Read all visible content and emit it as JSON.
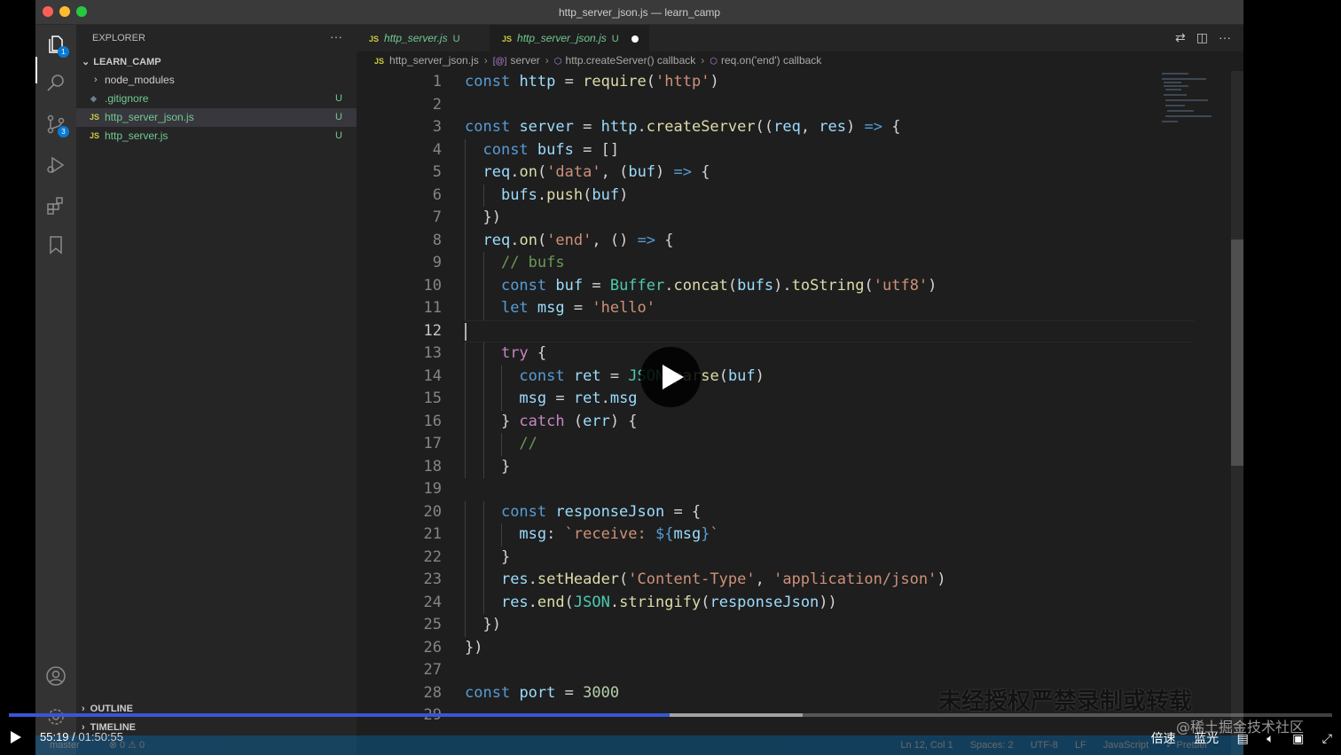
{
  "window": {
    "title": "http_server_json.js — learn_camp"
  },
  "activity_bar": {
    "explorer_badge": "1",
    "scm_badge": "3"
  },
  "sidebar": {
    "header": "EXPLORER",
    "more": "···",
    "section": "LEARN_CAMP",
    "items": [
      {
        "label": "node_modules",
        "status": "",
        "icon": "chevron-right-icon"
      },
      {
        "label": ".gitignore",
        "status": "U",
        "icon": "gitignore-icon"
      },
      {
        "label": "http_server_json.js",
        "status": "U",
        "icon": "JS"
      },
      {
        "label": "http_server.js",
        "status": "U",
        "icon": "JS"
      }
    ],
    "outline": "OUTLINE",
    "timeline": "TIMELINE"
  },
  "tabs": [
    {
      "icon": "JS",
      "label": "http_server.js",
      "status": "U"
    },
    {
      "icon": "JS",
      "label": "http_server_json.js",
      "status": "U"
    }
  ],
  "breadcrumb": {
    "file": "http_server_json.js",
    "items": [
      "server",
      "http.createServer() callback",
      "req.on('end') callback"
    ]
  },
  "code": {
    "current_line": 12,
    "lines": [
      "const http = require('http')",
      "",
      "const server = http.createServer((req, res) => {",
      "  const bufs = []",
      "  req.on('data', (buf) => {",
      "    bufs.push(buf)",
      "  })",
      "  req.on('end', () => {",
      "    // bufs",
      "    const buf = Buffer.concat(bufs).toString('utf8')",
      "    let msg = 'hello'",
      "",
      "    try {",
      "      const ret = JSON.parse(buf)",
      "      msg = ret.msg",
      "    } catch (err) {",
      "      //",
      "    }",
      "",
      "    const responseJson = {",
      "      msg: `receive: ${msg}`",
      "    }",
      "    res.setHeader('Content-Type', 'application/json')",
      "    res.end(JSON.stringify(responseJson))",
      "  })",
      "})",
      "",
      "const port = 3000",
      ""
    ]
  },
  "statusbar": {
    "branch": "master",
    "problems": "⊗ 0 ⚠ 0",
    "position": "Ln 12, Col 1",
    "spaces": "Spaces: 2",
    "encoding": "UTF-8",
    "eol": "LF",
    "language": "JavaScript",
    "formatter": "✓ Prettier"
  },
  "video": {
    "current_time": "55:19",
    "separator": " / ",
    "duration": "01:50:55",
    "progress": 0.499,
    "buffered": 0.6,
    "speed_label": "倍速",
    "quality_label": "蓝光",
    "notice": "未经授权严禁录制或转载",
    "watermark": "@稀土掘金技术社区"
  },
  "colors": {
    "keyword": "#569cd6",
    "variable": "#9cdcfe",
    "function": "#dcdcaa",
    "string": "#ce9178",
    "comment": "#6a9955",
    "number": "#b5cea8",
    "class": "#4ec9b0",
    "control": "#c586c0",
    "plain": "#d4d4d4"
  }
}
